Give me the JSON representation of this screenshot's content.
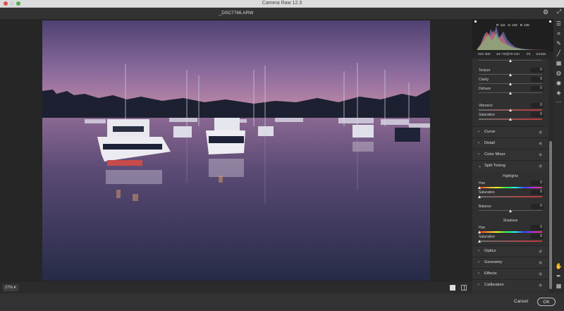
{
  "window": {
    "title": "Camera Raw 12.3"
  },
  "document": {
    "filename": "_DSC7766.ARW"
  },
  "histogram": {
    "r": "R: 111",
    "g": "G: 102",
    "b": "B: 125"
  },
  "meta": {
    "iso": "ISO 400",
    "lens": "24–70@70 mm",
    "aperture": "f/4",
    "shutter": "1/125s"
  },
  "presence": {
    "texture": {
      "label": "Texture",
      "value": "0"
    },
    "clarity": {
      "label": "Clarity",
      "value": "0"
    },
    "dehaze": {
      "label": "Dehaze",
      "value": "0"
    },
    "vibrance": {
      "label": "Vibrance",
      "value": "0"
    },
    "saturation": {
      "label": "Saturation",
      "value": "0"
    }
  },
  "sections": {
    "curve": "Curve",
    "detail": "Detail",
    "color_mixer": "Color Mixer",
    "split_toning": "Split Toning",
    "optics": "Optics",
    "geometry": "Geometry",
    "effects": "Effects",
    "calibration": "Calibration"
  },
  "split_toning": {
    "highlights_heading": "Highlights",
    "highlights_hue": {
      "label": "Hue",
      "value": "0"
    },
    "highlights_saturation": {
      "label": "Saturation",
      "value": "0"
    },
    "balance": {
      "label": "Balance",
      "value": "0"
    },
    "shadows_heading": "Shadows",
    "shadows_hue": {
      "label": "Hue",
      "value": "0"
    },
    "shadows_saturation": {
      "label": "Saturation",
      "value": "0"
    }
  },
  "bottom": {
    "zoom": "27%"
  },
  "buttons": {
    "cancel": "Cancel",
    "ok": "OK"
  },
  "icons": {
    "gear": "gear-icon",
    "fullscreen": "fullscreen-icon",
    "edit": "edit-sliders-icon",
    "crop": "crop-icon",
    "healing": "healing-brush-icon",
    "brush": "adjustment-brush-icon",
    "gradient": "graduated-filter-icon",
    "radial": "radial-filter-icon",
    "redeye": "red-eye-icon",
    "presets": "presets-icon",
    "more": "more-icon",
    "hand": "hand-icon",
    "sampler": "color-sampler-icon",
    "grid": "grid-icon"
  },
  "colors": {
    "accent_panel": "#2a2a2a",
    "sky_top": "#5b4a7c",
    "sky_horizon": "#c98aa9",
    "water": "#2a2f4e"
  }
}
